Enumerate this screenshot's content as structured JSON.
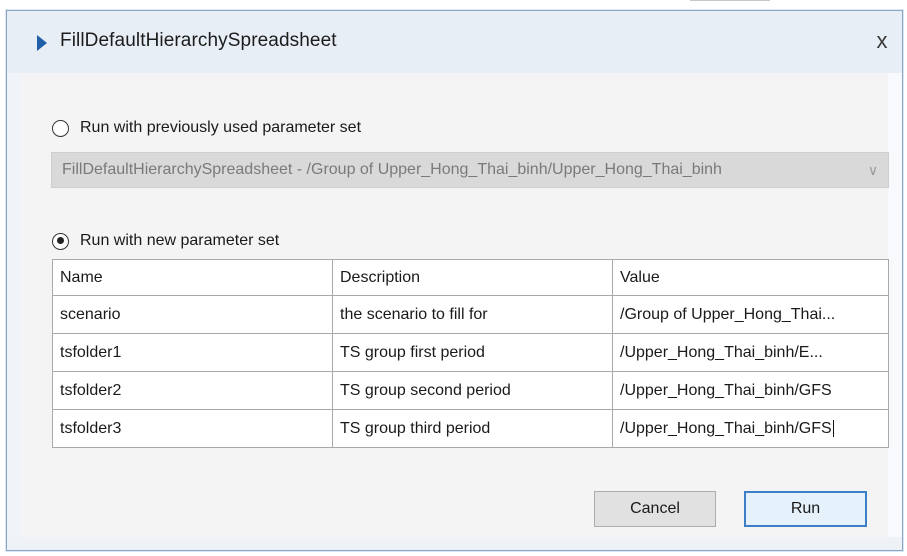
{
  "window": {
    "title": "FillDefaultHierarchySpreadsheet",
    "close_glyph": "x"
  },
  "options": {
    "previous_label": "Run with previously used parameter set",
    "previous_selected": false,
    "previous_combo_value": "FillDefaultHierarchySpreadsheet - /Group of Upper_Hong_Thai_binh/Upper_Hong_Thai_binh",
    "new_label": "Run with new parameter set",
    "new_selected": true
  },
  "parameters": {
    "columns": [
      "Name",
      "Description",
      "Value"
    ],
    "rows": [
      {
        "name": "scenario",
        "description": "the scenario to fill for",
        "value": "/Group of Upper_Hong_Thai..."
      },
      {
        "name": "tsfolder1",
        "description": "TS group first period",
        "value": "/Upper_Hong_Thai_binh/E..."
      },
      {
        "name": "tsfolder2",
        "description": "TS group second period",
        "value": "/Upper_Hong_Thai_binh/GFS"
      },
      {
        "name": "tsfolder3",
        "description": "TS group third period",
        "value": "/Upper_Hong_Thai_binh/GFS"
      }
    ]
  },
  "buttons": {
    "cancel_label": "Cancel",
    "run_label": "Run"
  },
  "icons": {
    "title_icon": "play-triangle-icon",
    "close_icon": "close-icon",
    "dropdown_icon": "chevron-down-icon"
  },
  "colors": {
    "accent": "#1f5fa8",
    "default_button_border": "#3c7fc6"
  }
}
